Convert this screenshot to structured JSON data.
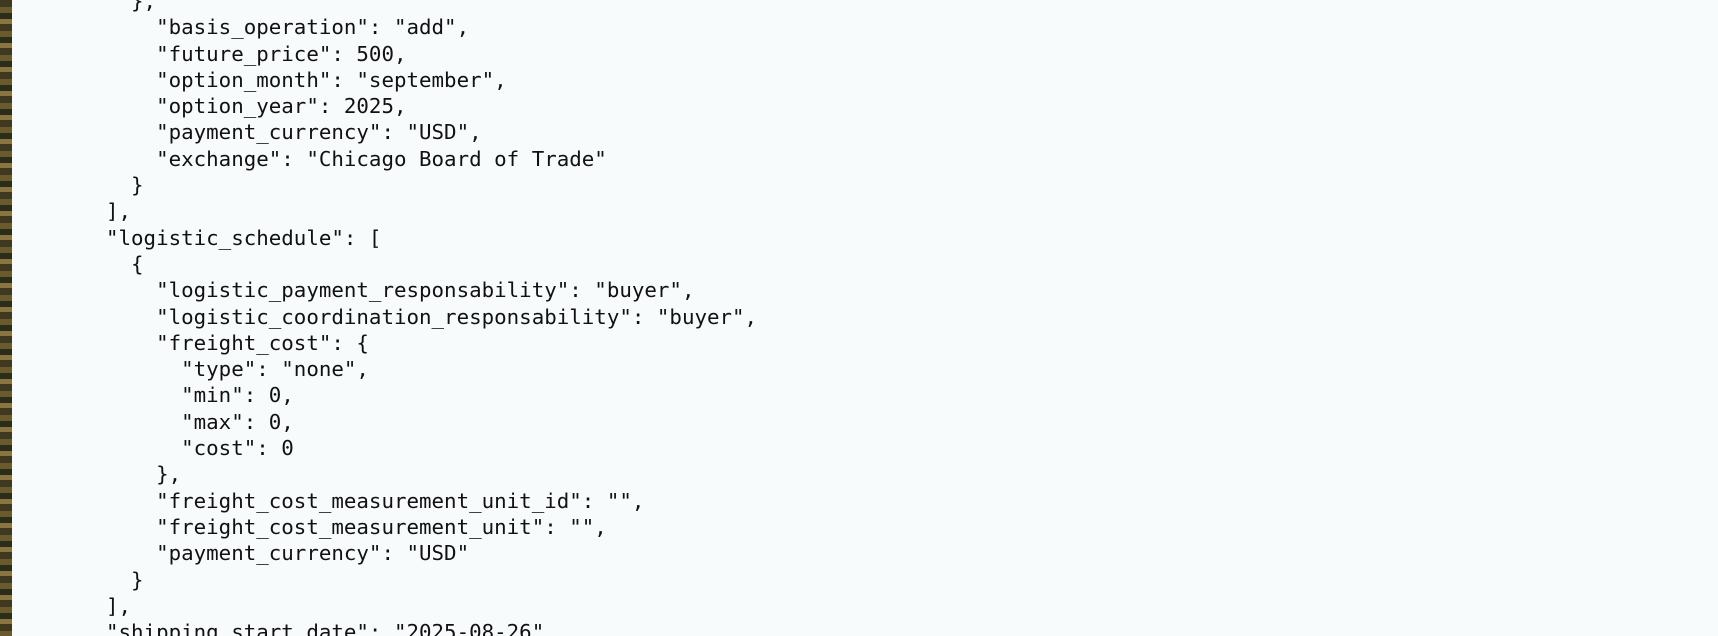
{
  "json_viewer": {
    "lines": [
      "  },",
      "    \"basis_operation\": \"add\",",
      "    \"future_price\": 500,",
      "    \"option_month\": \"september\",",
      "    \"option_year\": 2025,",
      "    \"payment_currency\": \"USD\",",
      "    \"exchange\": \"Chicago Board of Trade\"",
      "  }",
      "],",
      "\"logistic_schedule\": [",
      "  {",
      "    \"logistic_payment_responsability\": \"buyer\",",
      "    \"logistic_coordination_responsability\": \"buyer\",",
      "    \"freight_cost\": {",
      "      \"type\": \"none\",",
      "      \"min\": 0,",
      "      \"max\": 0,",
      "      \"cost\": 0",
      "    },",
      "    \"freight_cost_measurement_unit_id\": \"\",",
      "    \"freight_cost_measurement_unit\": \"\",",
      "    \"payment_currency\": \"USD\"",
      "  }",
      "],",
      "\"shipping_start_date\": \"2025-08-26\","
    ]
  }
}
